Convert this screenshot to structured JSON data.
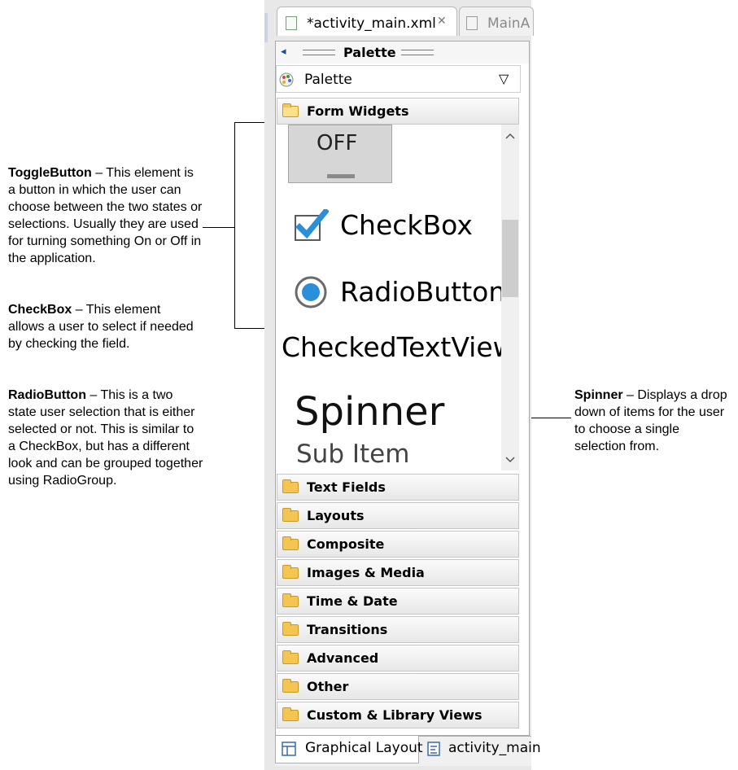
{
  "annotations": {
    "togglebutton": {
      "title": "ToggleButton",
      "text": " – This element is a button in which the user can choose between the two states or selections. Usually they are used for turning something On or Off in the application."
    },
    "checkbox": {
      "title": "CheckBox",
      "text": " – This element allows a user to select if needed by checking the field."
    },
    "radiobutton": {
      "title": "RadioButton",
      "text": " – This is a two state user selection that is either selected or not. This is similar to a CheckBox, but has a different look and can be grouped together using RadioGroup."
    },
    "spinner": {
      "title": "Spinner",
      "text": " – Displays a drop down of items for the user to choose a single selection from."
    }
  },
  "editor_tabs": [
    {
      "label": "*activity_main.xml",
      "close": "✕"
    },
    {
      "label": "MainA"
    }
  ],
  "palette": {
    "title": "Palette",
    "dropdown_label": "Palette",
    "dropdown_arrow": "▽",
    "collapse_arrow": "◂",
    "open_category": "Form Widgets",
    "widgets": {
      "toggle_off": "OFF",
      "checkbox": "CheckBox",
      "radiobutton": "RadioButton",
      "checked_text_view": "CheckedTextView",
      "spinner": "Spinner",
      "spinner_sub": "Sub Item"
    },
    "categories": [
      "Text Fields",
      "Layouts",
      "Composite",
      "Images & Media",
      "Time & Date",
      "Transitions",
      "Advanced",
      "Other",
      "Custom & Library Views"
    ]
  },
  "bottom_tabs": [
    "Graphical Layout",
    "activity_main"
  ],
  "colors": {
    "accent_blue": "#2a8fd8",
    "folder": "#f4c550"
  }
}
